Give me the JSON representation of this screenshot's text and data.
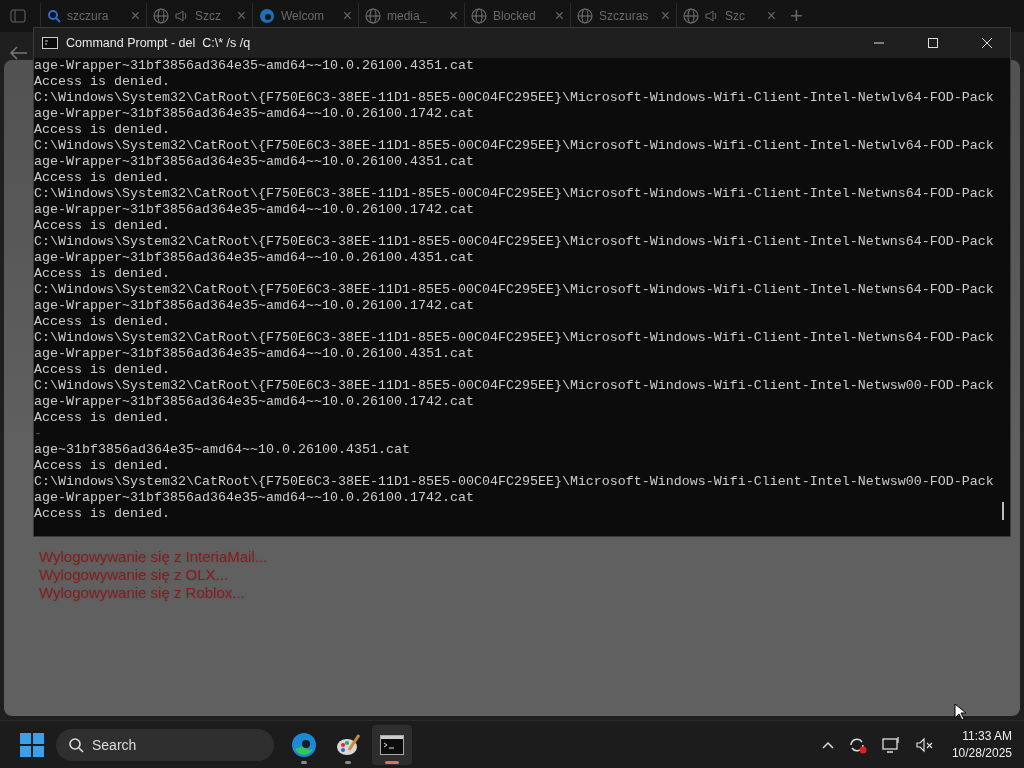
{
  "browser": {
    "tabs": [
      {
        "label": "szczura",
        "kind": "search",
        "audio": false,
        "close": "×"
      },
      {
        "label": "Szcz",
        "kind": "globe",
        "audio": true,
        "close": "×"
      },
      {
        "label": "Welcom",
        "kind": "edge",
        "audio": false,
        "close": "×"
      },
      {
        "label": "media_",
        "kind": "globe",
        "audio": false,
        "close": "×"
      },
      {
        "label": "Blocked",
        "kind": "globe",
        "audio": false,
        "close": "×"
      },
      {
        "label": "Szczuras",
        "kind": "globe",
        "audio": false,
        "close": "×"
      },
      {
        "label": "Szc",
        "kind": "globe",
        "audio": true,
        "close": "×"
      }
    ],
    "new_tab": "+",
    "messages": [
      "Wylogowywanie się z InteriaMail...",
      "Wylogowywanie się z OLX...",
      "Wylogowywanie się z Roblox..."
    ]
  },
  "console": {
    "title": "Command Prompt - del  C:\\* /s /q",
    "lines": [
      "age-Wrapper~31bf3856ad364e35~amd64~~10.0.26100.4351.cat",
      "Access is denied.",
      "C:\\Windows\\System32\\CatRoot\\{F750E6C3-38EE-11D1-85E5-00C04FC295EE}\\Microsoft-Windows-Wifi-Client-Intel-Netwlv64-FOD-Pack",
      "age-Wrapper~31bf3856ad364e35~amd64~~10.0.26100.1742.cat",
      "Access is denied.",
      "C:\\Windows\\System32\\CatRoot\\{F750E6C3-38EE-11D1-85E5-00C04FC295EE}\\Microsoft-Windows-Wifi-Client-Intel-Netwlv64-FOD-Pack",
      "age-Wrapper~31bf3856ad364e35~amd64~~10.0.26100.4351.cat",
      "Access is denied.",
      "C:\\Windows\\System32\\CatRoot\\{F750E6C3-38EE-11D1-85E5-00C04FC295EE}\\Microsoft-Windows-Wifi-Client-Intel-Netwns64-FOD-Pack",
      "age-Wrapper~31bf3856ad364e35~amd64~~10.0.26100.1742.cat",
      "Access is denied.",
      "C:\\Windows\\System32\\CatRoot\\{F750E6C3-38EE-11D1-85E5-00C04FC295EE}\\Microsoft-Windows-Wifi-Client-Intel-Netwns64-FOD-Pack",
      "age-Wrapper~31bf3856ad364e35~amd64~~10.0.26100.4351.cat",
      "Access is denied.",
      "C:\\Windows\\System32\\CatRoot\\{F750E6C3-38EE-11D1-85E5-00C04FC295EE}\\Microsoft-Windows-Wifi-Client-Intel-Netwns64-FOD-Pack",
      "age-Wrapper~31bf3856ad364e35~amd64~~10.0.26100.1742.cat",
      "Access is denied.",
      "C:\\Windows\\System32\\CatRoot\\{F750E6C3-38EE-11D1-85E5-00C04FC295EE}\\Microsoft-Windows-Wifi-Client-Intel-Netwns64-FOD-Pack",
      "age-Wrapper~31bf3856ad364e35~amd64~~10.0.26100.4351.cat",
      "Access is denied.",
      "C:\\Windows\\System32\\CatRoot\\{F750E6C3-38EE-11D1-85E5-00C04FC295EE}\\Microsoft-Windows-Wifi-Client-Intel-Netwsw00-FOD-Pack",
      "age-Wrapper~31bf3856ad364e35~amd64~~10.0.26100.1742.cat",
      "Access is denied.",
      "-",
      "age~31bf3856ad364e35~amd64~~10.0.26100.4351.cat",
      "Access is denied.",
      "C:\\Windows\\System32\\CatRoot\\{F750E6C3-38EE-11D1-85E5-00C04FC295EE}\\Microsoft-Windows-Wifi-Client-Intel-Netwsw00-FOD-Pack",
      "age-Wrapper~31bf3856ad364e35~amd64~~10.0.26100.1742.cat",
      "Access is denied."
    ]
  },
  "taskbar": {
    "search": {
      "placeholder": "Search"
    },
    "apps": [
      {
        "kind": "edge",
        "selected": false
      },
      {
        "kind": "paint",
        "selected": false
      },
      {
        "kind": "terminal",
        "selected": true
      }
    ],
    "time": "11:33 AM",
    "date": "10/28/2025"
  }
}
